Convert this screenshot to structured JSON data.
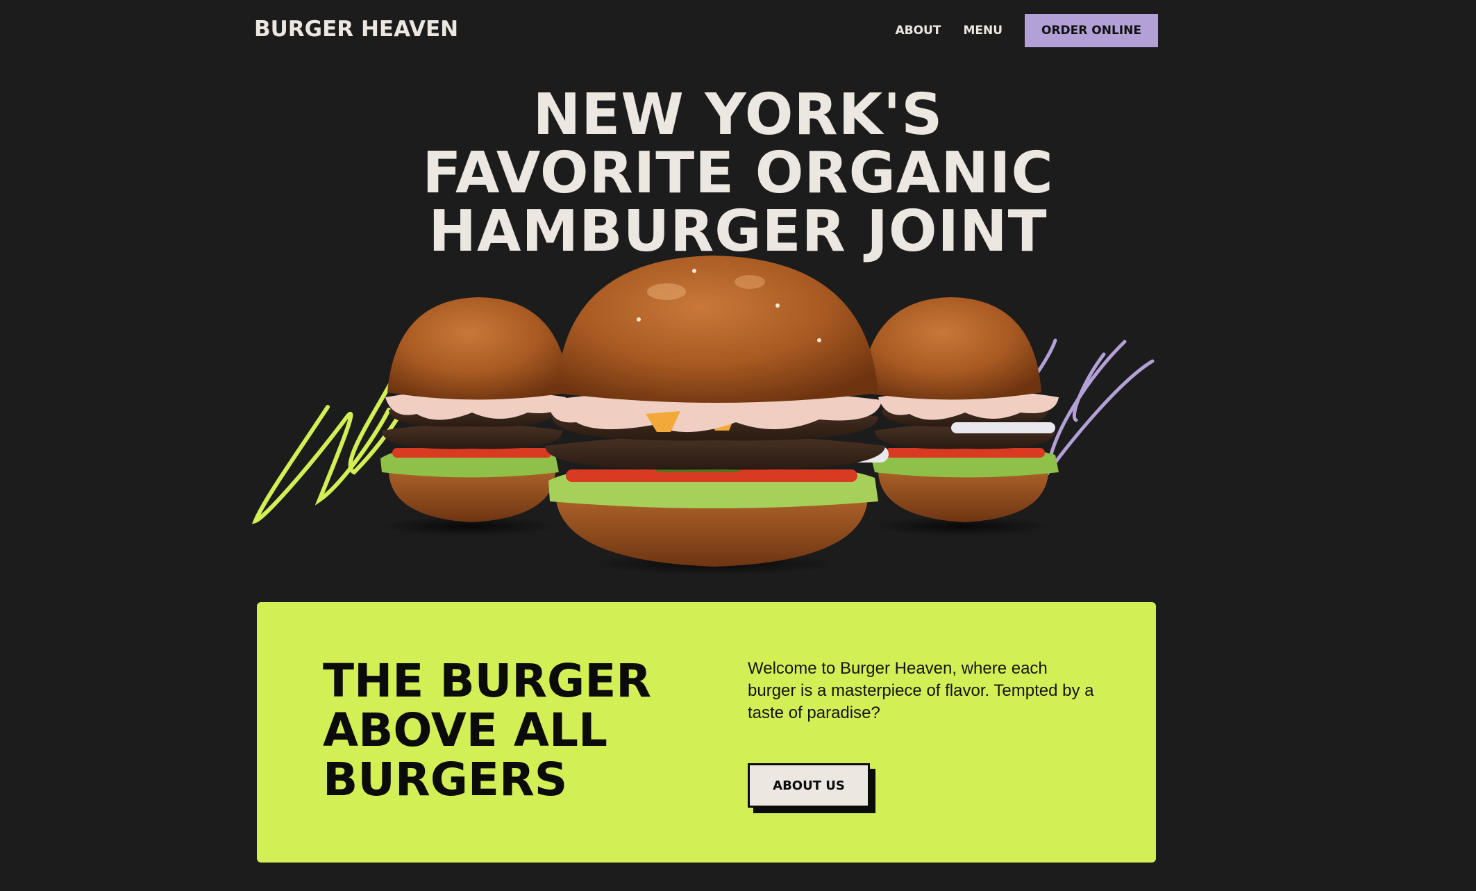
{
  "header": {
    "brand": "BURGER HEAVEN",
    "nav": [
      {
        "label": "ABOUT"
      },
      {
        "label": "MENU"
      }
    ],
    "cta_label": "ORDER ONLINE"
  },
  "hero": {
    "title_line1": "NEW YORK'S",
    "title_line2": "FAVORITE ORGANIC",
    "title_line3": "HAMBURGER JOINT"
  },
  "promo": {
    "title_line1": "THE BURGER",
    "title_line2": "ABOVE ALL",
    "title_line3": "BURGERS",
    "description": "Welcome to Burger Heaven, where each burger is a masterpiece of flavor. Tempted by a taste of paradise?",
    "button_label": "ABOUT US"
  },
  "colors": {
    "background": "#1c1c1c",
    "text_light": "#ece7e1",
    "accent_purple": "#b3a0d7",
    "accent_lime": "#d3ef56"
  },
  "icons": {
    "lime_scribble": "scribble-lime-icon",
    "purple_scribble": "scribble-purple-icon"
  }
}
